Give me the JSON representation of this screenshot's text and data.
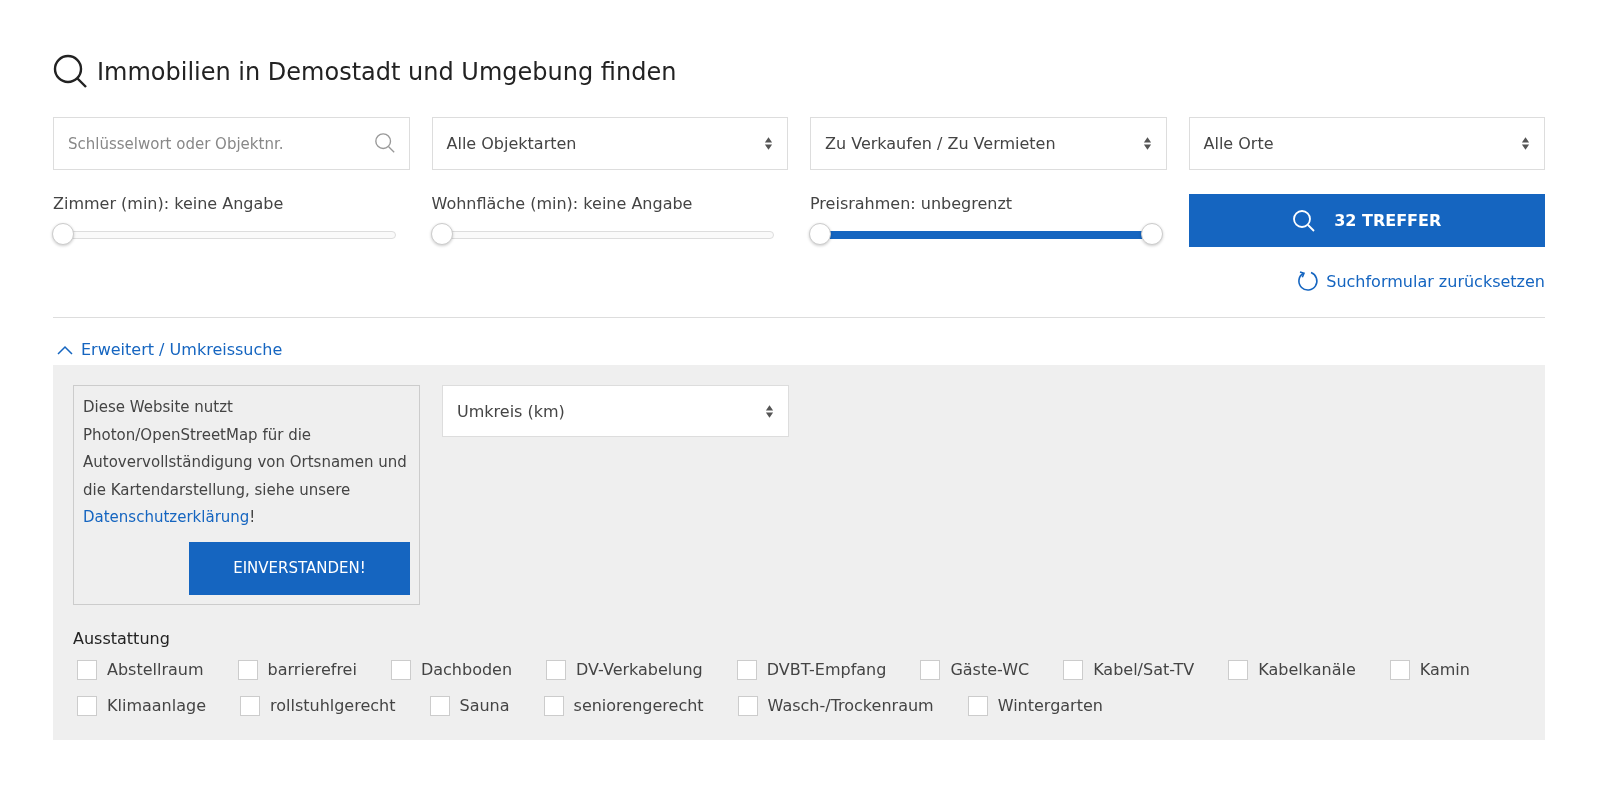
{
  "title": "Immobilien in Demostadt und Umgebung finden",
  "fields": [
    {
      "kind": "search",
      "placeholder": "Schlüsselwort oder Objektnr."
    },
    {
      "kind": "select",
      "value": "Alle Objektarten"
    },
    {
      "kind": "select",
      "value": "Zu Verkaufen / Zu Vermieten"
    },
    {
      "kind": "select",
      "value": "Alle Orte"
    }
  ],
  "sliders": [
    {
      "kind": "single",
      "label": "Zimmer (min): keine Angabe",
      "level": 0
    },
    {
      "kind": "single",
      "label": "Wohnfläche (min): keine Angabe",
      "level": 0
    },
    {
      "kind": "range",
      "label": "Preisrahmen: unbegrenzt",
      "level": 1
    }
  ],
  "search_button": "32 TREFFER",
  "reset_link": "Suchformular zurücksetzen",
  "advanced": {
    "label": "Erweitert / Umkreissuche",
    "expanded": true,
    "notice": {
      "text": "Diese Website nutzt Photon/OpenStreetMap für die Autovervollständigung von Ortsnamen und die Kartendarstellung, siehe unsere",
      "link": "Datenschutzerklärung",
      "after": "!",
      "button": "EINVERSTANDEN!"
    },
    "radius_select": "Umkreis (km)",
    "features_label": "Ausstattung",
    "features": [
      {
        "label": "Abstellraum",
        "checked": false
      },
      {
        "label": "barrierefrei",
        "checked": false
      },
      {
        "label": "Dachboden",
        "checked": false
      },
      {
        "label": "DV-Verkabelung",
        "checked": false
      },
      {
        "label": "DVBT-Empfang",
        "checked": false
      },
      {
        "label": "Gäste-WC",
        "checked": false
      },
      {
        "label": "Kabel/Sat-TV",
        "checked": false
      },
      {
        "label": "Kabelkanäle",
        "checked": false
      },
      {
        "label": "Kamin",
        "checked": false
      },
      {
        "label": "Klimaanlage",
        "checked": false
      },
      {
        "label": "rollstuhlgerecht",
        "checked": false
      },
      {
        "label": "Sauna",
        "checked": false
      },
      {
        "label": "seniorengerecht",
        "checked": false
      },
      {
        "label": "Wasch-/Trockenraum",
        "checked": false
      },
      {
        "label": "Wintergarten",
        "checked": false
      }
    ]
  }
}
